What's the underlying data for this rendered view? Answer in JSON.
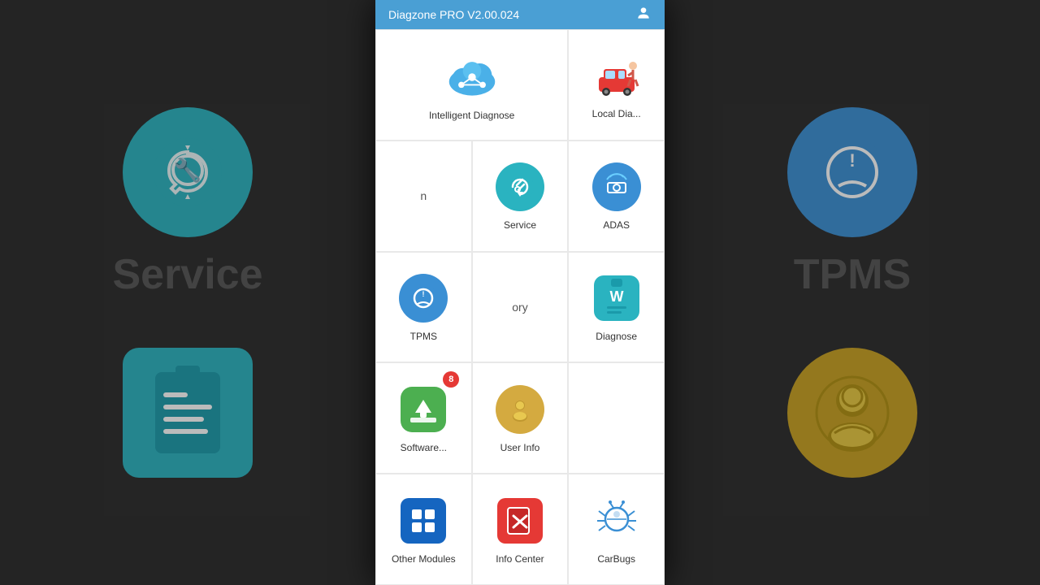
{
  "app": {
    "title": "Diagzone PRO V2.00.024",
    "version": "V2.00.024"
  },
  "header": {
    "title": "Diagzone PRO V2.00.024",
    "user_icon": "👤"
  },
  "background": {
    "left_sections": [
      {
        "icon": "service",
        "label": "Service",
        "color": "#2ab3c0"
      },
      {
        "icon": "diagnose-report",
        "label": "",
        "color": "#2ab3c0"
      }
    ],
    "right_sections": [
      {
        "icon": "tpms",
        "label": "TPMS",
        "color": "#3a8fd4"
      },
      {
        "icon": "user-info",
        "label": "",
        "color": "#d4aa40"
      }
    ]
  },
  "grid": {
    "rows": [
      [
        {
          "id": "intelligent-diagnose",
          "label": "Intelligent Diagnose",
          "icon": "cloud-network",
          "wide": true,
          "badge": null
        },
        {
          "id": "local-diagnose",
          "label": "Local Dia...",
          "icon": "car-repair",
          "wide": false,
          "badge": null
        }
      ],
      [
        {
          "id": "menu-partial",
          "label": "n",
          "icon": "partial",
          "wide": false,
          "badge": null
        },
        {
          "id": "service",
          "label": "Service",
          "icon": "service-circle",
          "wide": false,
          "badge": null
        },
        {
          "id": "adas",
          "label": "ADAS",
          "icon": "adas-circle",
          "wide": false,
          "badge": null
        },
        {
          "id": "tpms",
          "label": "TPMS",
          "icon": "tpms-circle",
          "wide": false,
          "badge": null
        }
      ],
      [
        {
          "id": "history-partial",
          "label": "ory",
          "icon": "partial-history",
          "wide": false,
          "badge": null
        },
        {
          "id": "diagnose-report",
          "label": "Diagnose",
          "icon": "report-clipboard",
          "wide": false,
          "badge": null
        },
        {
          "id": "software-update",
          "label": "Software...",
          "icon": "software-update",
          "wide": false,
          "badge": 8
        },
        {
          "id": "user-info",
          "label": "User Info",
          "icon": "user-circle",
          "wide": false,
          "badge": null
        }
      ],
      [
        {
          "id": "other-modules",
          "label": "Other Modules",
          "icon": "other-modules",
          "wide": false,
          "badge": null
        },
        {
          "id": "info-center",
          "label": "Info Center",
          "icon": "info-center",
          "wide": false,
          "badge": null
        },
        {
          "id": "carbugs",
          "label": "CarBugs",
          "icon": "carbugs",
          "wide": false,
          "badge": null
        }
      ]
    ]
  }
}
